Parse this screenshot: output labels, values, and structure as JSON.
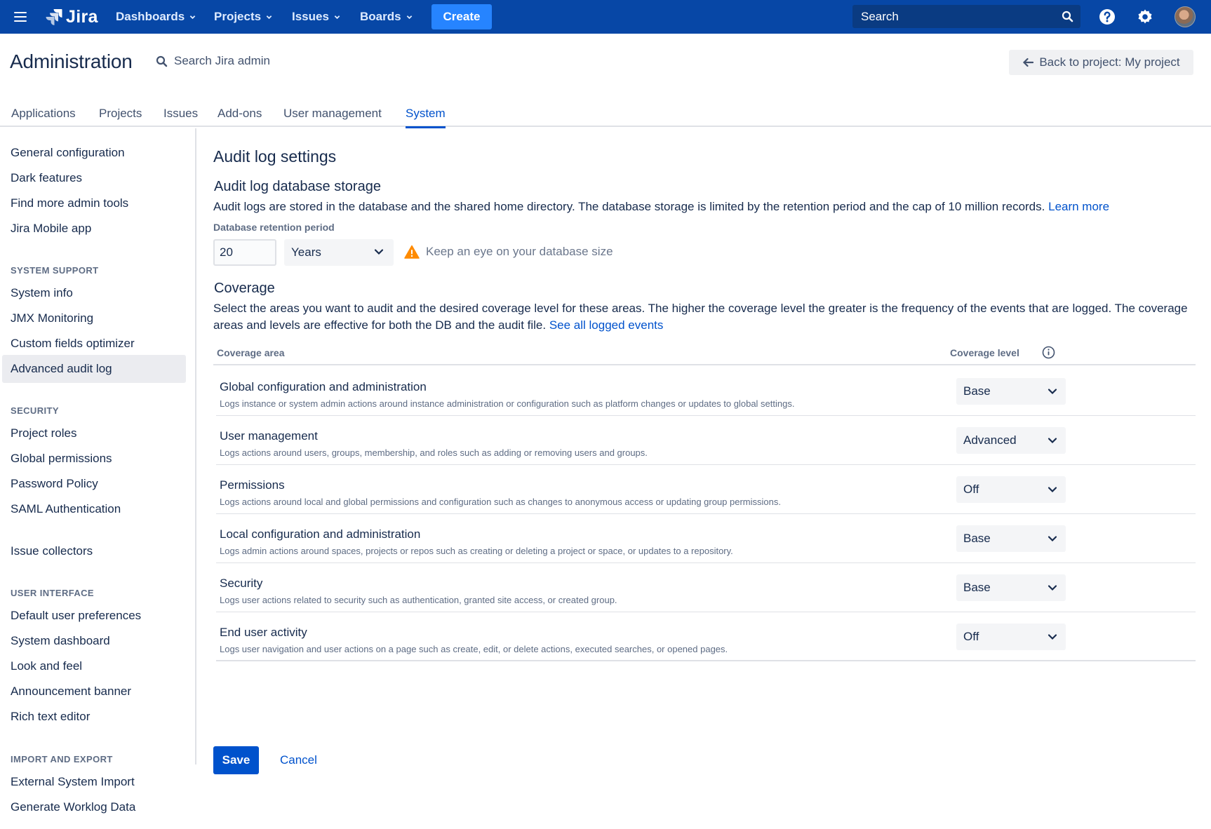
{
  "topnav": {
    "logo": "Jira",
    "menu": [
      "Dashboards",
      "Projects",
      "Issues",
      "Boards"
    ],
    "create_label": "Create",
    "search_placeholder": "Search",
    "brand_color": "#0747a6",
    "accent_color": "#2684ff"
  },
  "header": {
    "title": "Administration",
    "search_label": "Search Jira admin",
    "back_label": "Back to project: My project"
  },
  "tabs": [
    "Applications",
    "Projects",
    "Issues",
    "Add-ons",
    "User management",
    "System"
  ],
  "active_tab": "System",
  "sidebar": {
    "items_top": [
      "General configuration",
      "Dark features",
      "Find more admin tools",
      "Jira Mobile app"
    ],
    "system_support": {
      "heading": "SYSTEM SUPPORT",
      "items": [
        "System info",
        "JMX Monitoring",
        "Custom fields optimizer",
        "Advanced audit log"
      ]
    },
    "security": {
      "heading": "SECURITY",
      "items": [
        "Project roles",
        "Global permissions",
        "Password Policy",
        "SAML Authentication"
      ]
    },
    "issue_collectors": "Issue collectors",
    "user_interface": {
      "heading": "USER INTERFACE",
      "items": [
        "Default user preferences",
        "System dashboard",
        "Look and feel",
        "Announcement banner",
        "Rich text editor"
      ]
    },
    "import_export": {
      "heading": "IMPORT AND EXPORT",
      "items": [
        "External System Import",
        "Generate Worklog Data"
      ]
    }
  },
  "main": {
    "title": "Audit log settings",
    "storage": {
      "heading": "Audit log database storage",
      "description": "Audit logs are stored in the database and the shared home directory. The database storage is limited by the retention period and the cap of 10 million records.",
      "learn_more": "Learn more",
      "retention_label": "Database retention period",
      "retention_value": "20",
      "retention_unit": "Years",
      "warning": "Keep an eye on your database size"
    },
    "coverage": {
      "heading": "Coverage",
      "description": "Select the areas you want to audit and the desired coverage level for these areas. The higher the coverage level the greater is the frequency of the events that are logged. The coverage areas and levels are effective for both the DB and the audit file.",
      "see_all": "See all logged events",
      "col_area": "Coverage area",
      "col_level": "Coverage level",
      "rows": [
        {
          "title": "Global configuration and administration",
          "desc": "Logs instance or system admin actions around instance administration or configuration such as platform changes or updates to global settings.",
          "level": "Base"
        },
        {
          "title": "User management",
          "desc": "Logs actions around users, groups, membership, and roles such as adding or removing users and groups.",
          "level": "Advanced"
        },
        {
          "title": "Permissions",
          "desc": "Logs actions around local and global permissions and configuration such as changes to anonymous access or updating group permissions.",
          "level": "Off"
        },
        {
          "title": "Local configuration and administration",
          "desc": "Logs admin actions around spaces, projects or repos such as creating or deleting a project or space, or updates to a repository.",
          "level": "Base"
        },
        {
          "title": "Security",
          "desc": "Logs user actions related to security such as authentication, granted site access, or created group.",
          "level": "Base"
        },
        {
          "title": "End user activity",
          "desc": "Logs user navigation and user actions on a page such as create, edit, or delete actions, executed searches, or opened pages.",
          "level": "Off"
        }
      ]
    },
    "save_label": "Save",
    "cancel_label": "Cancel"
  }
}
